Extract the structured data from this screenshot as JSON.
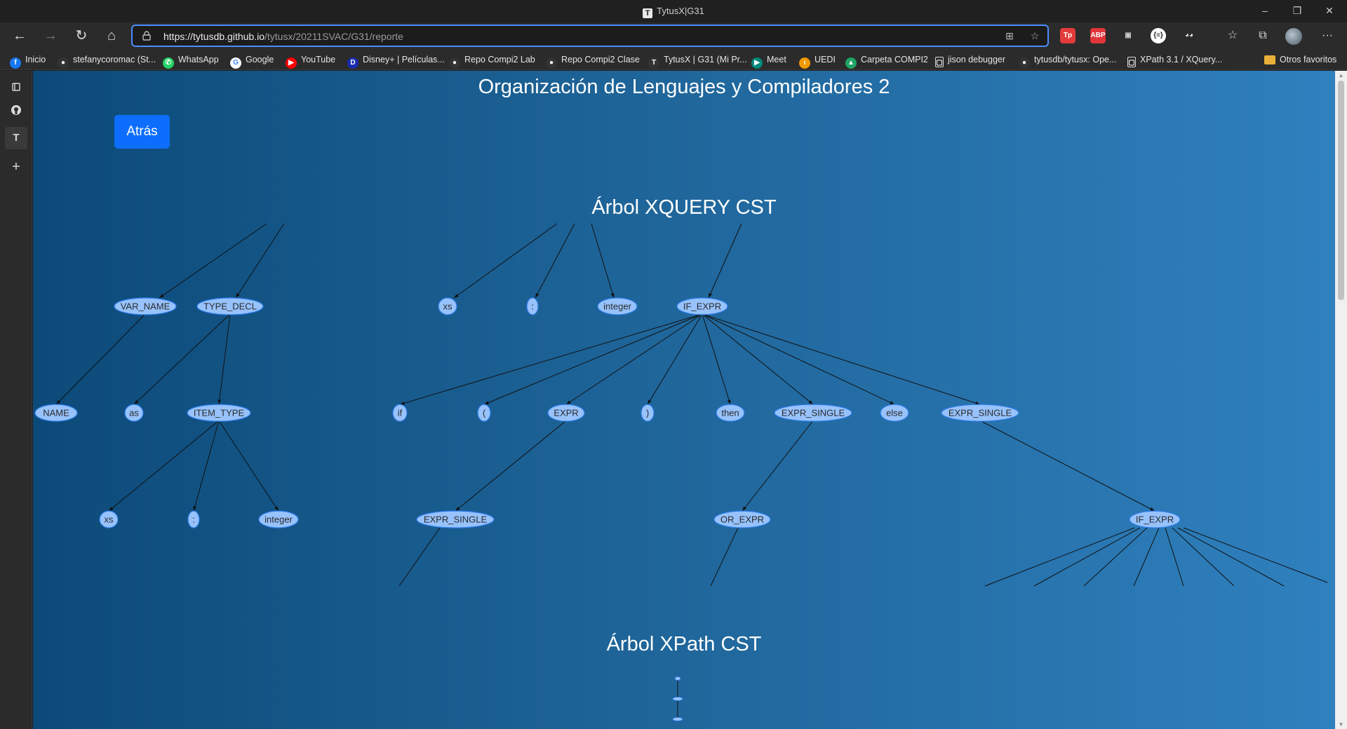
{
  "window": {
    "title": "TytusX|G31",
    "tab_icon_letter": "T",
    "controls": {
      "minimize": "–",
      "restore": "❐",
      "close": "✕"
    }
  },
  "toolbar": {
    "url_host": "https://tytusdb.github.io",
    "url_path": "/tytusx/20211SVAC/G31/reporte",
    "back_icon": "←",
    "forward_icon": "→",
    "reload_icon": "↻",
    "home_icon": "⌂",
    "more_icon": "···"
  },
  "extensions": [
    {
      "name": "tp-extension-icon",
      "label": "Tp",
      "color": "#e23b3b",
      "text": "#fff"
    },
    {
      "name": "abp-extension-icon",
      "label": "ABP",
      "color": "#e0353a",
      "text": "#fff"
    },
    {
      "name": "extension-icon",
      "label": "▣",
      "color": "#2b2b2b",
      "text": "#ccc"
    },
    {
      "name": "json-extension-icon",
      "label": "{≡}",
      "color": "#ffffff",
      "text": "#222"
    },
    {
      "name": "spy-extension-icon",
      "label": "◕◕",
      "color": "#2b2b2b",
      "text": "#ddd"
    }
  ],
  "bookmarks": [
    {
      "label": "Inicio",
      "icon": "f",
      "color": "#1877f2"
    },
    {
      "label": "stefanycoromac (St...",
      "icon": "●",
      "color": "#333"
    },
    {
      "label": "WhatsApp",
      "icon": "✆",
      "color": "#25d366"
    },
    {
      "label": "Google",
      "icon": "G",
      "color": "#ffffff"
    },
    {
      "label": "YouTube",
      "icon": "▶",
      "color": "#ff0000"
    },
    {
      "label": "Disney+ | Películas...",
      "icon": "D",
      "color": "#1a2bb0"
    },
    {
      "label": "Repo Compi2 Lab",
      "icon": "●",
      "color": "#333"
    },
    {
      "label": "Repo Compi2 Clase",
      "icon": "●",
      "color": "#333"
    },
    {
      "label": "TytusX | G31 (Mi Pr...",
      "icon": "T",
      "color": "#333"
    },
    {
      "label": "Meet",
      "icon": "▶",
      "color": "#00897b"
    },
    {
      "label": "UEDI",
      "icon": "ı",
      "color": "#f29900"
    },
    {
      "label": "Carpeta COMPI2",
      "icon": "▲",
      "color": "#1fa463"
    },
    {
      "label": "jison debugger",
      "icon": "▢",
      "color": "#2b2b2b"
    },
    {
      "label": "tytusdb/tytusx: Ope...",
      "icon": "●",
      "color": "#333"
    },
    {
      "label": "XPath 3.1 / XQuery...",
      "icon": "▢",
      "color": "#2b2b2b"
    }
  ],
  "other_favorites": "Otros favoritos",
  "page": {
    "heading": "Organización de Lenguajes y Compiladores 2",
    "back_button": "Atrás",
    "xquery_title": "Árbol XQUERY CST",
    "xpath_title": "Árbol XPath CST"
  },
  "xquery_tree": {
    "nodes": [
      {
        "id": "var_name",
        "label": "VAR_NAME"
      },
      {
        "id": "type_decl",
        "label": "TYPE_DECL"
      },
      {
        "id": "xs1",
        "label": "xs"
      },
      {
        "id": "colon1",
        "label": ":"
      },
      {
        "id": "integer1",
        "label": "integer"
      },
      {
        "id": "if_expr1",
        "label": "IF_EXPR"
      },
      {
        "id": "name_cut",
        "label": "NAME"
      },
      {
        "id": "as",
        "label": "as"
      },
      {
        "id": "item_type",
        "label": "ITEM_TYPE"
      },
      {
        "id": "if_kw",
        "label": "if"
      },
      {
        "id": "lparen",
        "label": "("
      },
      {
        "id": "expr",
        "label": "EXPR"
      },
      {
        "id": "rparen",
        "label": ")"
      },
      {
        "id": "then",
        "label": "then"
      },
      {
        "id": "expr_single1",
        "label": "EXPR_SINGLE"
      },
      {
        "id": "else",
        "label": "else"
      },
      {
        "id": "expr_single2",
        "label": "EXPR_SINGLE"
      },
      {
        "id": "xs2",
        "label": "xs"
      },
      {
        "id": "colon2",
        "label": ":"
      },
      {
        "id": "integer2",
        "label": "integer"
      },
      {
        "id": "expr_single3",
        "label": "EXPR_SINGLE"
      },
      {
        "id": "or_expr",
        "label": "OR_EXPR"
      },
      {
        "id": "if_expr2",
        "label": "IF_EXPR"
      }
    ],
    "edges": [
      [
        "if_expr1",
        "if_kw"
      ],
      [
        "if_expr1",
        "lparen"
      ],
      [
        "if_expr1",
        "expr"
      ],
      [
        "if_expr1",
        "rparen"
      ],
      [
        "if_expr1",
        "then"
      ],
      [
        "if_expr1",
        "expr_single1"
      ],
      [
        "if_expr1",
        "else"
      ],
      [
        "if_expr1",
        "expr_single2"
      ],
      [
        "var_name",
        "name_cut"
      ],
      [
        "type_decl",
        "as"
      ],
      [
        "type_decl",
        "item_type"
      ],
      [
        "item_type",
        "xs2"
      ],
      [
        "item_type",
        "colon2"
      ],
      [
        "item_type",
        "integer2"
      ],
      [
        "expr",
        "expr_single3"
      ],
      [
        "expr_single1",
        "or_expr"
      ],
      [
        "expr_single2",
        "if_expr2"
      ]
    ]
  }
}
